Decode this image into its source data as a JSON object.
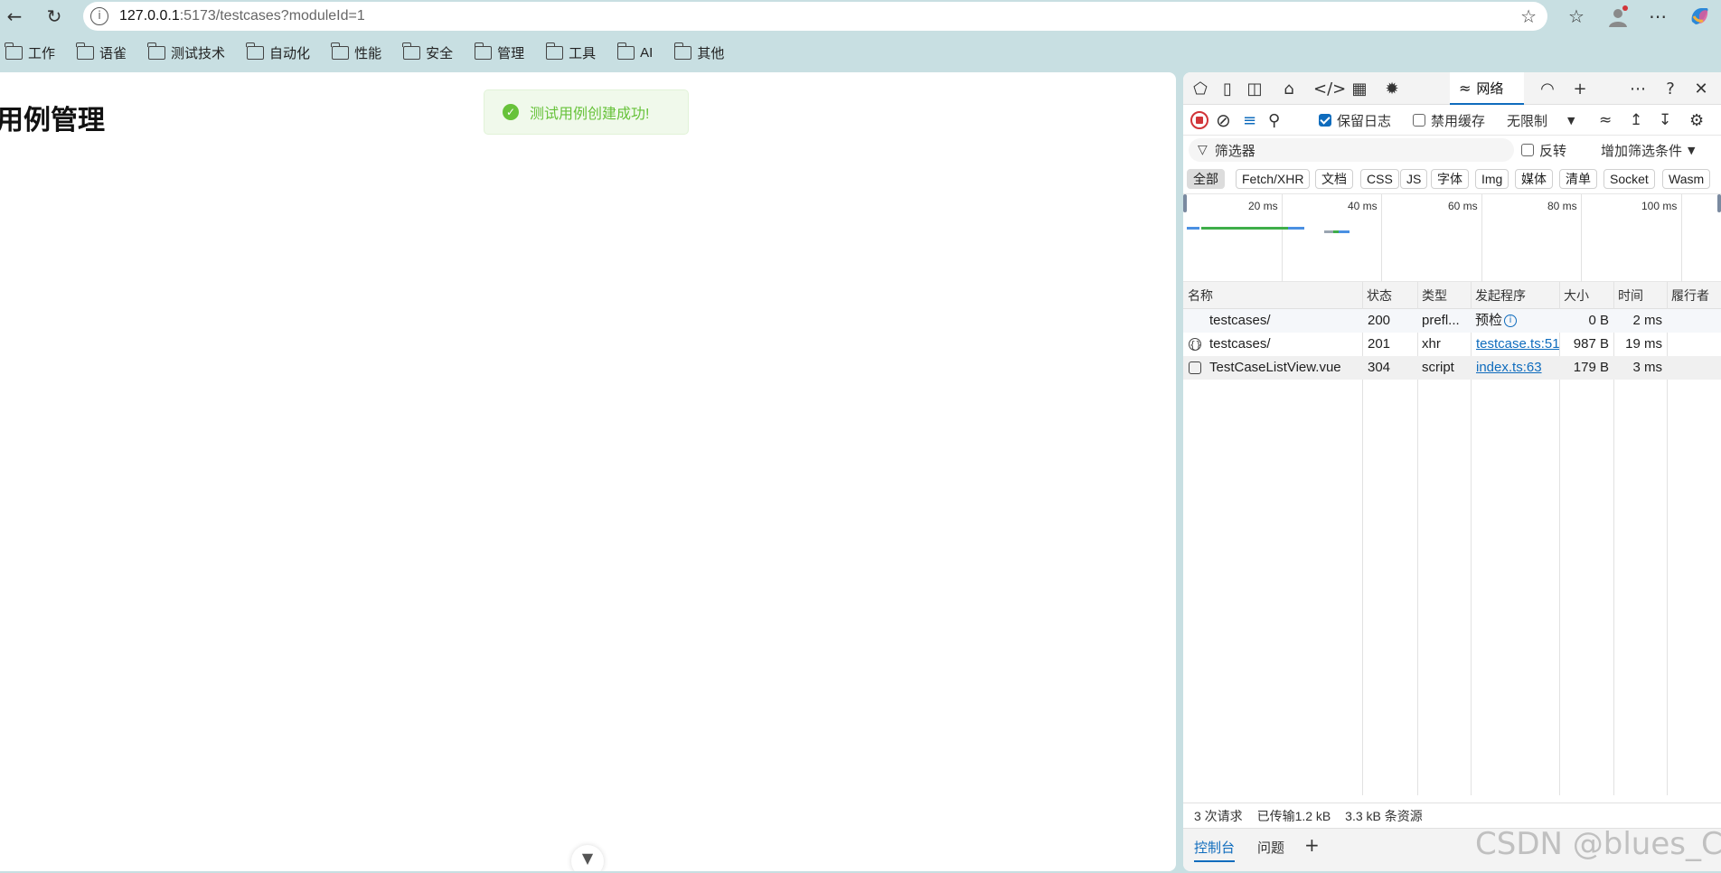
{
  "browser": {
    "url_host": "127.0.0.1",
    "url_rest": ":5173/testcases?moduleId=1"
  },
  "bookmarks": [
    {
      "label": "工作"
    },
    {
      "label": "语雀"
    },
    {
      "label": "测试技术"
    },
    {
      "label": "自动化"
    },
    {
      "label": "性能"
    },
    {
      "label": "安全"
    },
    {
      "label": "管理"
    },
    {
      "label": "工具"
    },
    {
      "label": "AI"
    },
    {
      "label": "其他"
    }
  ],
  "page": {
    "title": "用例管理",
    "toast": {
      "icon": "check-circle-icon",
      "text": "测试用例创建成功!",
      "color": "#67c23a"
    }
  },
  "devtools": {
    "network_tab": "网络",
    "preserve_log": {
      "label": "保留日志",
      "checked": true
    },
    "disable_cache": {
      "label": "禁用缓存",
      "checked": false
    },
    "throttling": "无限制",
    "filter_placeholder": "筛选器",
    "invert": {
      "label": "反转",
      "checked": false
    },
    "more_filters": "增加筛选条件",
    "type_filters": [
      "全部",
      "Fetch/XHR",
      "文档",
      "CSS",
      "JS",
      "字体",
      "Img",
      "媒体",
      "清单",
      "Socket",
      "Wasm"
    ],
    "active_type": "全部",
    "timeline_ticks": [
      "20 ms",
      "40 ms",
      "60 ms",
      "80 ms",
      "100 ms"
    ],
    "columns": [
      "名称",
      "状态",
      "类型",
      "发起程序",
      "大小",
      "时间",
      "履行者"
    ],
    "requests": [
      {
        "name": "testcases/",
        "status": "200",
        "type": "prefl...",
        "initiator": "预检",
        "initiator_is_link": false,
        "size": "0 B",
        "time": "2 ms",
        "icon": "none"
      },
      {
        "name": "testcases/",
        "status": "201",
        "type": "xhr",
        "initiator": "testcase.ts:51",
        "initiator_is_link": true,
        "size": "987 B",
        "time": "19 ms",
        "icon": "xhr-icon"
      },
      {
        "name": "TestCaseListView.vue",
        "status": "304",
        "type": "script",
        "initiator": "index.ts:63",
        "initiator_is_link": true,
        "size": "179 B",
        "time": "3 ms",
        "icon": "script-icon"
      }
    ],
    "status_bar": {
      "requests": "3 次请求",
      "transferred": "已传输1.2 kB",
      "resources": "3.3 kB 条资源"
    },
    "drawer": {
      "console": "控制台",
      "issues": "问题"
    }
  },
  "watermark": "CSDN @blues_C",
  "colors": {
    "accent": "#0f6cbd",
    "record": "#d13438",
    "success": "#67c23a"
  }
}
